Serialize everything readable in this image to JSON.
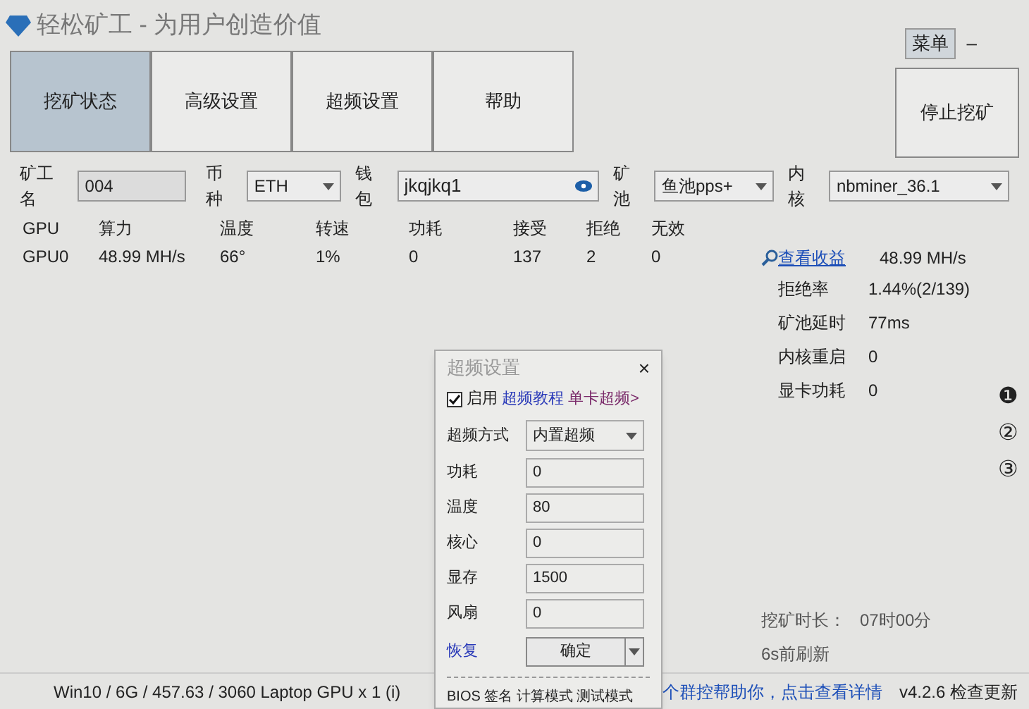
{
  "window": {
    "title": "轻松矿工 - 为用户创造价值",
    "menu_button": "菜单",
    "minimize": "–"
  },
  "tabs": [
    {
      "label": "挖矿状态",
      "selected": true
    },
    {
      "label": "高级设置",
      "selected": false
    },
    {
      "label": "超频设置",
      "selected": false
    },
    {
      "label": "帮助",
      "selected": false
    }
  ],
  "stop_button": "停止挖矿",
  "form": {
    "worker_label": "矿工名",
    "worker": "004",
    "coin_label": "币种",
    "coin": "ETH",
    "wallet_label": "钱包",
    "wallet": "jkqjkq1",
    "pool_label": "矿池",
    "pool": "鱼池pps+",
    "kernel_label": "内核",
    "kernel": "nbminer_36.1"
  },
  "table": {
    "columns": [
      "GPU",
      "算力",
      "温度",
      "转速",
      "功耗",
      "接受",
      "拒绝",
      "无效"
    ],
    "rows": [
      [
        "GPU0",
        "48.99 MH/s",
        "66°",
        "1%",
        "0",
        "137",
        "2",
        "0"
      ]
    ]
  },
  "stats": {
    "link": "查看收益",
    "hashrate": "48.99 MH/s",
    "items": [
      {
        "label": "拒绝率",
        "value": "1.44%(2/139)"
      },
      {
        "label": "矿池延时",
        "value": "77ms"
      },
      {
        "label": "内核重启",
        "value": "0"
      },
      {
        "label": "显卡功耗",
        "value": "0"
      }
    ]
  },
  "side_buttons": [
    "❶",
    "②",
    "③"
  ],
  "mining_time": {
    "label": "挖矿时长：",
    "value": "07时00分"
  },
  "refresh": "6s前刷新",
  "status_bar": {
    "system": "Win10  / 6G / 457.63 / 3060 Laptop GPU x 1 (i)",
    "notice": "个群控帮助你，点击查看详情",
    "version": "v4.2.6 检查更新"
  },
  "dialog": {
    "title": "超频设置",
    "close": "×",
    "enabled": {
      "label": "启用",
      "checked": true
    },
    "tutorial": "超频教程",
    "single_card": "单卡超频>",
    "mode_label": "超频方式",
    "mode": "内置超频",
    "fields": [
      {
        "label": "功耗",
        "value": "0"
      },
      {
        "label": "温度",
        "value": "80"
      },
      {
        "label": "核心",
        "value": "0"
      },
      {
        "label": "显存",
        "value": "1500"
      },
      {
        "label": "风扇",
        "value": "0"
      }
    ],
    "restore": "恢复",
    "confirm": "确定",
    "footer": "BIOS 签名 计算模式 测试模式"
  }
}
